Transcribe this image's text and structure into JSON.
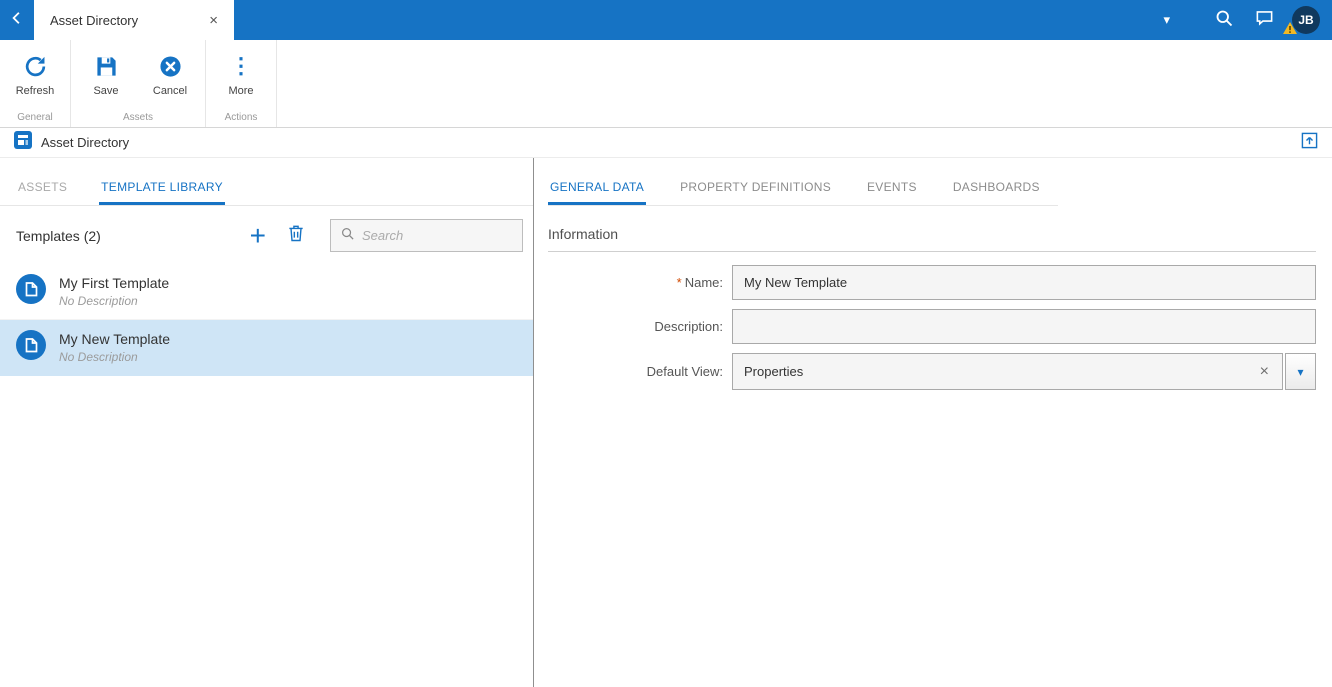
{
  "colors": {
    "accent": "#1673c4",
    "topbar": "#1673c4",
    "selected_item_bg": "#cfe5f6",
    "warning_badge": "#f2b824",
    "required_marker": "#d14900"
  },
  "topbar": {
    "tab": {
      "title": "Asset Directory",
      "close_glyph": "×"
    },
    "caret_glyph": "▾",
    "avatar_initials": "JB"
  },
  "ribbon": {
    "refresh_label": "Refresh",
    "save_label": "Save",
    "cancel_label": "Cancel",
    "more_label": "More",
    "more_glyph": "⋮",
    "groups": {
      "general": "General",
      "assets": "Assets",
      "actions": "Actions"
    }
  },
  "titlebar": {
    "title": "Asset Directory"
  },
  "left_panel": {
    "tabs": [
      {
        "label": "ASSETS"
      },
      {
        "label": "TEMPLATE LIBRARY"
      }
    ],
    "count_label": "Templates (2)",
    "add_glyph": "+",
    "search_placeholder": "Search",
    "items": [
      {
        "title": "My First Template",
        "subtitle": "No Description"
      },
      {
        "title": "My New Template",
        "subtitle": "No Description"
      }
    ]
  },
  "right_panel": {
    "tabs": [
      {
        "label": "GENERAL DATA"
      },
      {
        "label": "PROPERTY DEFINITIONS"
      },
      {
        "label": "EVENTS"
      },
      {
        "label": "DASHBOARDS"
      }
    ],
    "section_title": "Information",
    "form": {
      "required_marker": "*",
      "name_label": "Name:",
      "name_value": "My New Template",
      "description_label": "Description:",
      "description_value": "",
      "default_view_label": "Default View:",
      "default_view_value": "Properties",
      "clear_glyph": "×",
      "caret_glyph": "▾"
    }
  }
}
